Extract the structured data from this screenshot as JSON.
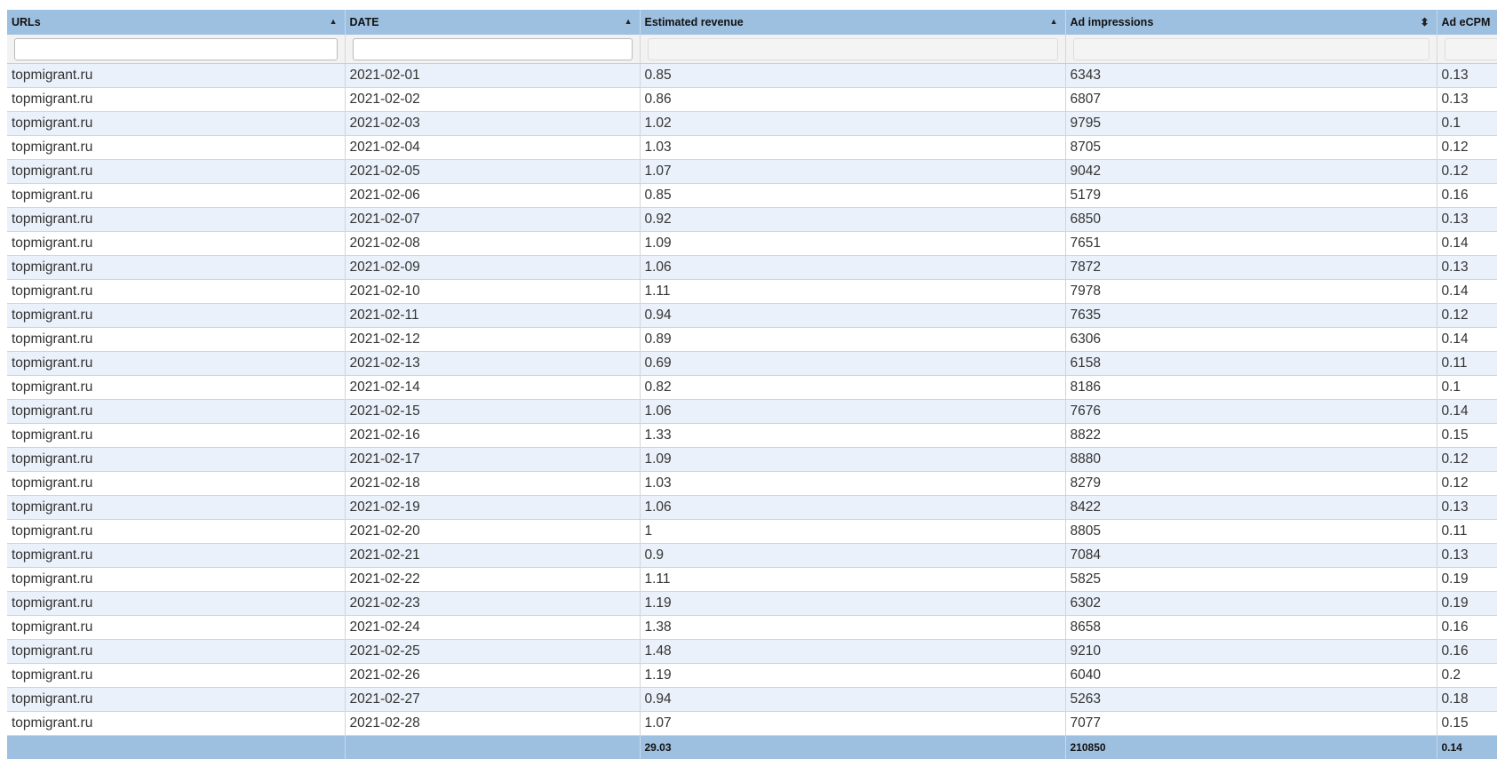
{
  "columns": [
    {
      "label": "URLs",
      "sort": "asc"
    },
    {
      "label": "DATE",
      "sort": "asc"
    },
    {
      "label": "Estimated revenue",
      "sort": "asc"
    },
    {
      "label": "Ad impressions",
      "sort": "both"
    },
    {
      "label": "Ad eCPM",
      "sort": ""
    }
  ],
  "rows": [
    [
      "topmigrant.ru",
      "2021-02-01",
      "0.85",
      "6343",
      "0.13"
    ],
    [
      "topmigrant.ru",
      "2021-02-02",
      "0.86",
      "6807",
      "0.13"
    ],
    [
      "topmigrant.ru",
      "2021-02-03",
      "1.02",
      "9795",
      "0.1"
    ],
    [
      "topmigrant.ru",
      "2021-02-04",
      "1.03",
      "8705",
      "0.12"
    ],
    [
      "topmigrant.ru",
      "2021-02-05",
      "1.07",
      "9042",
      "0.12"
    ],
    [
      "topmigrant.ru",
      "2021-02-06",
      "0.85",
      "5179",
      "0.16"
    ],
    [
      "topmigrant.ru",
      "2021-02-07",
      "0.92",
      "6850",
      "0.13"
    ],
    [
      "topmigrant.ru",
      "2021-02-08",
      "1.09",
      "7651",
      "0.14"
    ],
    [
      "topmigrant.ru",
      "2021-02-09",
      "1.06",
      "7872",
      "0.13"
    ],
    [
      "topmigrant.ru",
      "2021-02-10",
      "1.11",
      "7978",
      "0.14"
    ],
    [
      "topmigrant.ru",
      "2021-02-11",
      "0.94",
      "7635",
      "0.12"
    ],
    [
      "topmigrant.ru",
      "2021-02-12",
      "0.89",
      "6306",
      "0.14"
    ],
    [
      "topmigrant.ru",
      "2021-02-13",
      "0.69",
      "6158",
      "0.11"
    ],
    [
      "topmigrant.ru",
      "2021-02-14",
      "0.82",
      "8186",
      "0.1"
    ],
    [
      "topmigrant.ru",
      "2021-02-15",
      "1.06",
      "7676",
      "0.14"
    ],
    [
      "topmigrant.ru",
      "2021-02-16",
      "1.33",
      "8822",
      "0.15"
    ],
    [
      "topmigrant.ru",
      "2021-02-17",
      "1.09",
      "8880",
      "0.12"
    ],
    [
      "topmigrant.ru",
      "2021-02-18",
      "1.03",
      "8279",
      "0.12"
    ],
    [
      "topmigrant.ru",
      "2021-02-19",
      "1.06",
      "8422",
      "0.13"
    ],
    [
      "topmigrant.ru",
      "2021-02-20",
      "1",
      "8805",
      "0.11"
    ],
    [
      "topmigrant.ru",
      "2021-02-21",
      "0.9",
      "7084",
      "0.13"
    ],
    [
      "topmigrant.ru",
      "2021-02-22",
      "1.11",
      "5825",
      "0.19"
    ],
    [
      "topmigrant.ru",
      "2021-02-23",
      "1.19",
      "6302",
      "0.19"
    ],
    [
      "topmigrant.ru",
      "2021-02-24",
      "1.38",
      "8658",
      "0.16"
    ],
    [
      "topmigrant.ru",
      "2021-02-25",
      "1.48",
      "9210",
      "0.16"
    ],
    [
      "topmigrant.ru",
      "2021-02-26",
      "1.19",
      "6040",
      "0.2"
    ],
    [
      "topmigrant.ru",
      "2021-02-27",
      "0.94",
      "5263",
      "0.18"
    ],
    [
      "topmigrant.ru",
      "2021-02-28",
      "1.07",
      "7077",
      "0.15"
    ]
  ],
  "footer": [
    "",
    "",
    "29.03",
    "210850",
    "0.14"
  ],
  "filters": [
    {
      "value": "",
      "placeholder": ""
    },
    {
      "value": "",
      "placeholder": ""
    },
    {
      "value": "",
      "placeholder": ""
    },
    {
      "value": "",
      "placeholder": ""
    },
    {
      "value": "",
      "placeholder": ""
    }
  ],
  "colors": {
    "header_bg": "#9dbfe0",
    "row_alt": "#eaf1fa"
  }
}
